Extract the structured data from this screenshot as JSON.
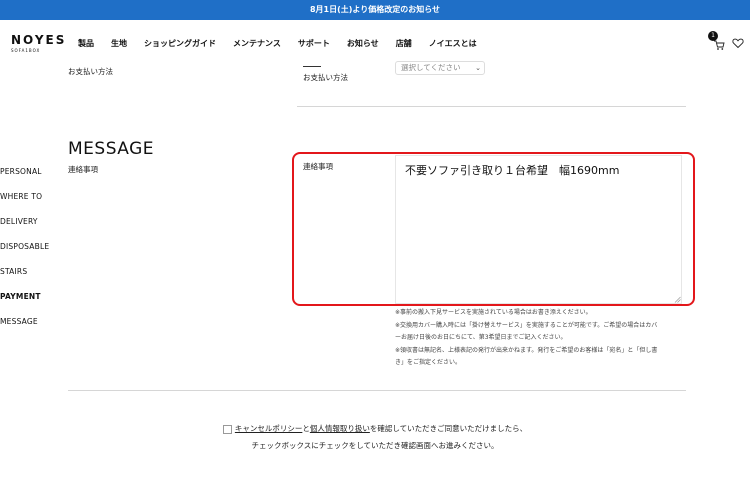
{
  "announcement": "8月1日(土)より価格改定のお知らせ",
  "header": {
    "logo": "NOYES",
    "logo_sub": "SOFA1BOX",
    "nav": [
      "製品",
      "生地",
      "ショッピングガイド",
      "メンテナンス",
      "サポート",
      "お知らせ",
      "店舗",
      "ノイエスとは"
    ],
    "cart_count": "1"
  },
  "side_nav": [
    "PERSONAL",
    "WHERE TO",
    "DELIVERY",
    "DISPOSABLE",
    "STAIRS",
    "PAYMENT",
    "MESSAGE"
  ],
  "payment": {
    "left_label": "お支払い方法",
    "field_label": "お支払い方法",
    "select_value": "選択してください"
  },
  "message": {
    "title": "MESSAGE",
    "left_label": "連絡事項",
    "field_label": "連絡事項",
    "value": "不要ソファ引き取り１台希望　幅1690mm"
  },
  "notes": [
    "※事前の搬入下見サービスを実施されている場合はお書き添えください。",
    "※交換用カバー購入時には「掛け替えサービス」を実施することが可能です。ご希望の場合はカバ",
    "ーお届け日後のお日にちにて、第3希望日までご記入ください。",
    "※領収書は無記名、上様表記の発行が出来かねます。発行をご希望のお客様は「宛名」と「但し書",
    "き」をご指定ください。"
  ],
  "consent": {
    "link1": "キャンセルポリシー",
    "and": "と",
    "link2": "個人情報取り扱い",
    "rest": "を確認していただきご同意いただけましたら、",
    "line2": "チェックボックスにチェックをしていただき確認画面へお進みください。"
  },
  "colors": {
    "announce_bg": "#1f6fc7",
    "highlight": "#e3171b"
  }
}
